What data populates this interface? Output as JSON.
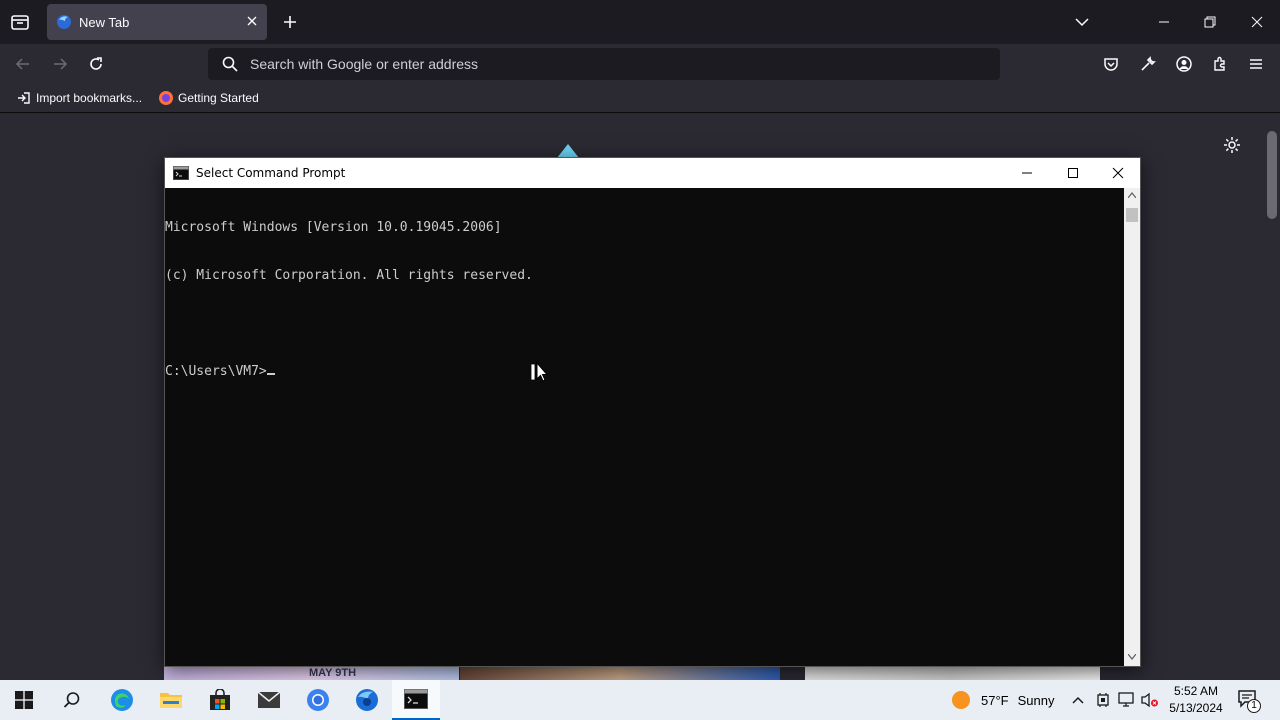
{
  "browser": {
    "tab": {
      "title": "New Tab"
    },
    "urlbar": {
      "placeholder": "Search with Google or enter address"
    },
    "bookmarks": [
      {
        "label": "Import bookmarks..."
      },
      {
        "label": "Getting Started"
      }
    ]
  },
  "cmd_window": {
    "title": "Select Command Prompt",
    "lines": [
      "Microsoft Windows [Version 10.0.19045.2006]",
      "(c) Microsoft Corporation. All rights reserved.",
      "",
      "C:\\Users\\VM7>"
    ]
  },
  "taskbar": {
    "weather": {
      "temp": "57°F",
      "condition": "Sunny"
    },
    "clock": {
      "time": "5:52 AM",
      "date": "5/13/2024"
    },
    "notification_count": "1"
  },
  "wallpaper_peek_text": "MAY 9TH",
  "colors": {
    "accent": "#0067c0",
    "browser_bg": "#2b2a33",
    "console_bg": "#0c0c0c",
    "console_text": "#cccccc"
  }
}
